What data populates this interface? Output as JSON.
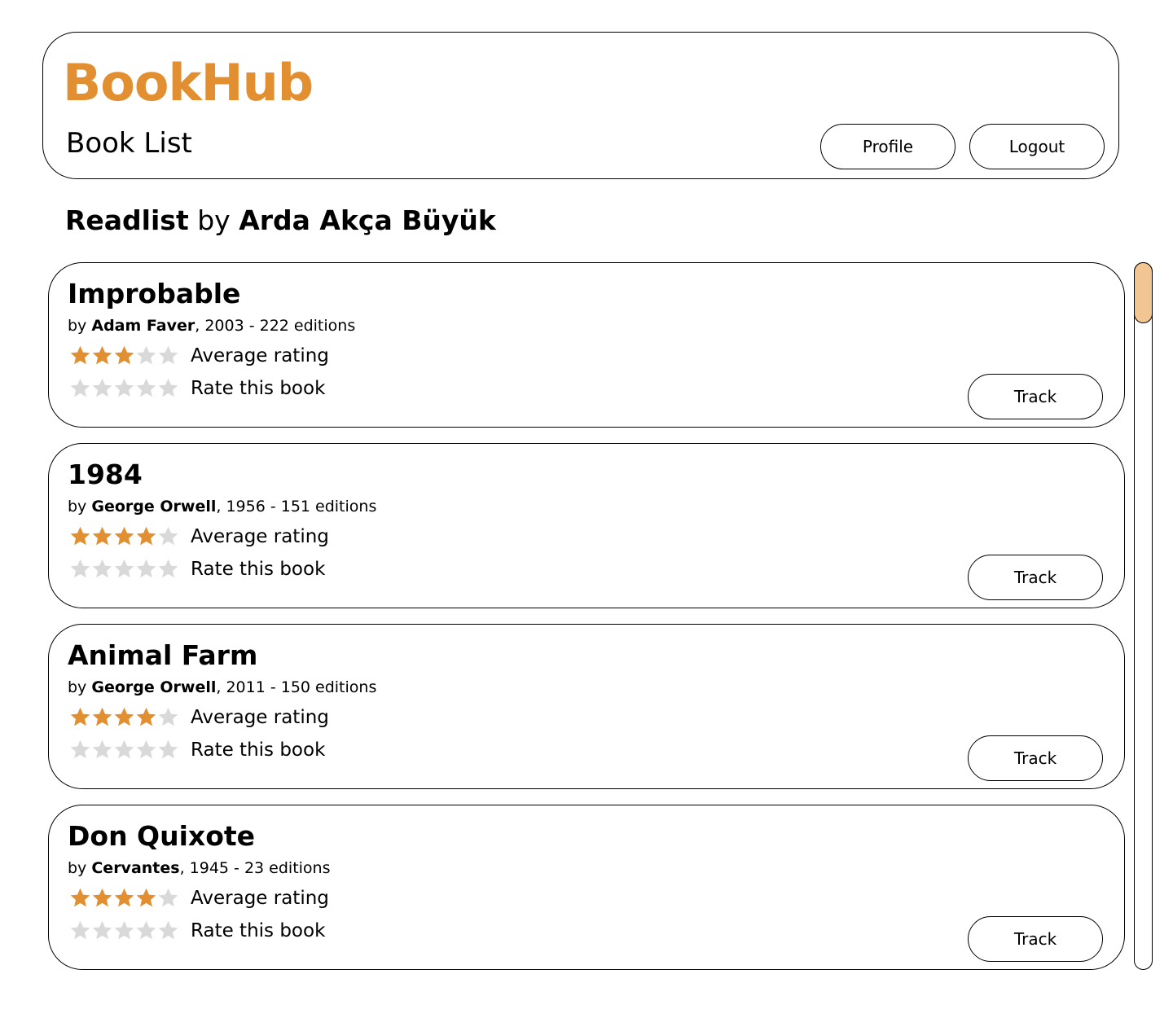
{
  "app": {
    "logo": "BookHub",
    "page_title": "Book List"
  },
  "nav": {
    "profile_label": "Profile",
    "logout_label": "Logout"
  },
  "readlist": {
    "word_readlist": "Readlist",
    "word_by": "by",
    "owner": "Arda Akça Büyük"
  },
  "labels": {
    "average_rating": "Average rating",
    "rate_this_book": "Rate this book",
    "track": "Track",
    "by": "by"
  },
  "colors": {
    "accent": "#e28f31",
    "star_filled": "#e28f31",
    "star_empty": "#d9d9d9",
    "scroll_thumb": "#f2c693"
  },
  "icons": {
    "star": "star-icon"
  },
  "books": [
    {
      "title": "Improbable",
      "author": "Adam Faver",
      "details": ", 2003 - 222 editions",
      "average_stars": 3,
      "user_stars": 0,
      "max_stars": 5
    },
    {
      "title": "1984",
      "author": "George Orwell",
      "details": ", 1956 - 151 editions",
      "average_stars": 4,
      "user_stars": 0,
      "max_stars": 5
    },
    {
      "title": "Animal Farm",
      "author": "George Orwell",
      "details": ", 2011 - 150 editions",
      "average_stars": 4,
      "user_stars": 0,
      "max_stars": 5
    },
    {
      "title": "Don Quixote",
      "author": "Cervantes",
      "details": ", 1945 - 23 editions",
      "average_stars": 4,
      "user_stars": 0,
      "max_stars": 5
    }
  ],
  "scroll": {
    "position_fraction": 0.0
  }
}
